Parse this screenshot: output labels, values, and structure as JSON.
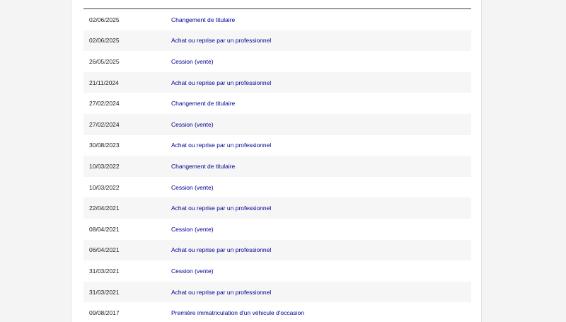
{
  "history": {
    "rows": [
      {
        "date": "02/06/2025",
        "operation": "Changement de titulaire"
      },
      {
        "date": "02/06/2025",
        "operation": "Achat ou reprise par un professionnel"
      },
      {
        "date": "26/05/2025",
        "operation": "Cession (vente)"
      },
      {
        "date": "21/11/2024",
        "operation": "Achat ou reprise par un professionnel"
      },
      {
        "date": "27/02/2024",
        "operation": "Changement de titulaire"
      },
      {
        "date": "27/02/2024",
        "operation": "Cession (vente)"
      },
      {
        "date": "30/08/2023",
        "operation": "Achat ou reprise par un professionnel"
      },
      {
        "date": "10/03/2022",
        "operation": "Changement de titulaire"
      },
      {
        "date": "10/03/2022",
        "operation": "Cession (vente)"
      },
      {
        "date": "22/04/2021",
        "operation": "Achat ou reprise par un professionnel"
      },
      {
        "date": "08/04/2021",
        "operation": "Cession (vente)"
      },
      {
        "date": "06/04/2021",
        "operation": "Achat ou reprise par un professionnel"
      },
      {
        "date": "31/03/2021",
        "operation": "Cession (vente)"
      },
      {
        "date": "31/03/2021",
        "operation": "Achat ou reprise par un professionnel"
      },
      {
        "date": "09/08/2017",
        "operation": "Première immatriculation d'un véhicule d'occasion"
      }
    ]
  },
  "colors": {
    "link": "#000091",
    "text": "#1e1e1e",
    "stripe": "#f6f6f6"
  }
}
